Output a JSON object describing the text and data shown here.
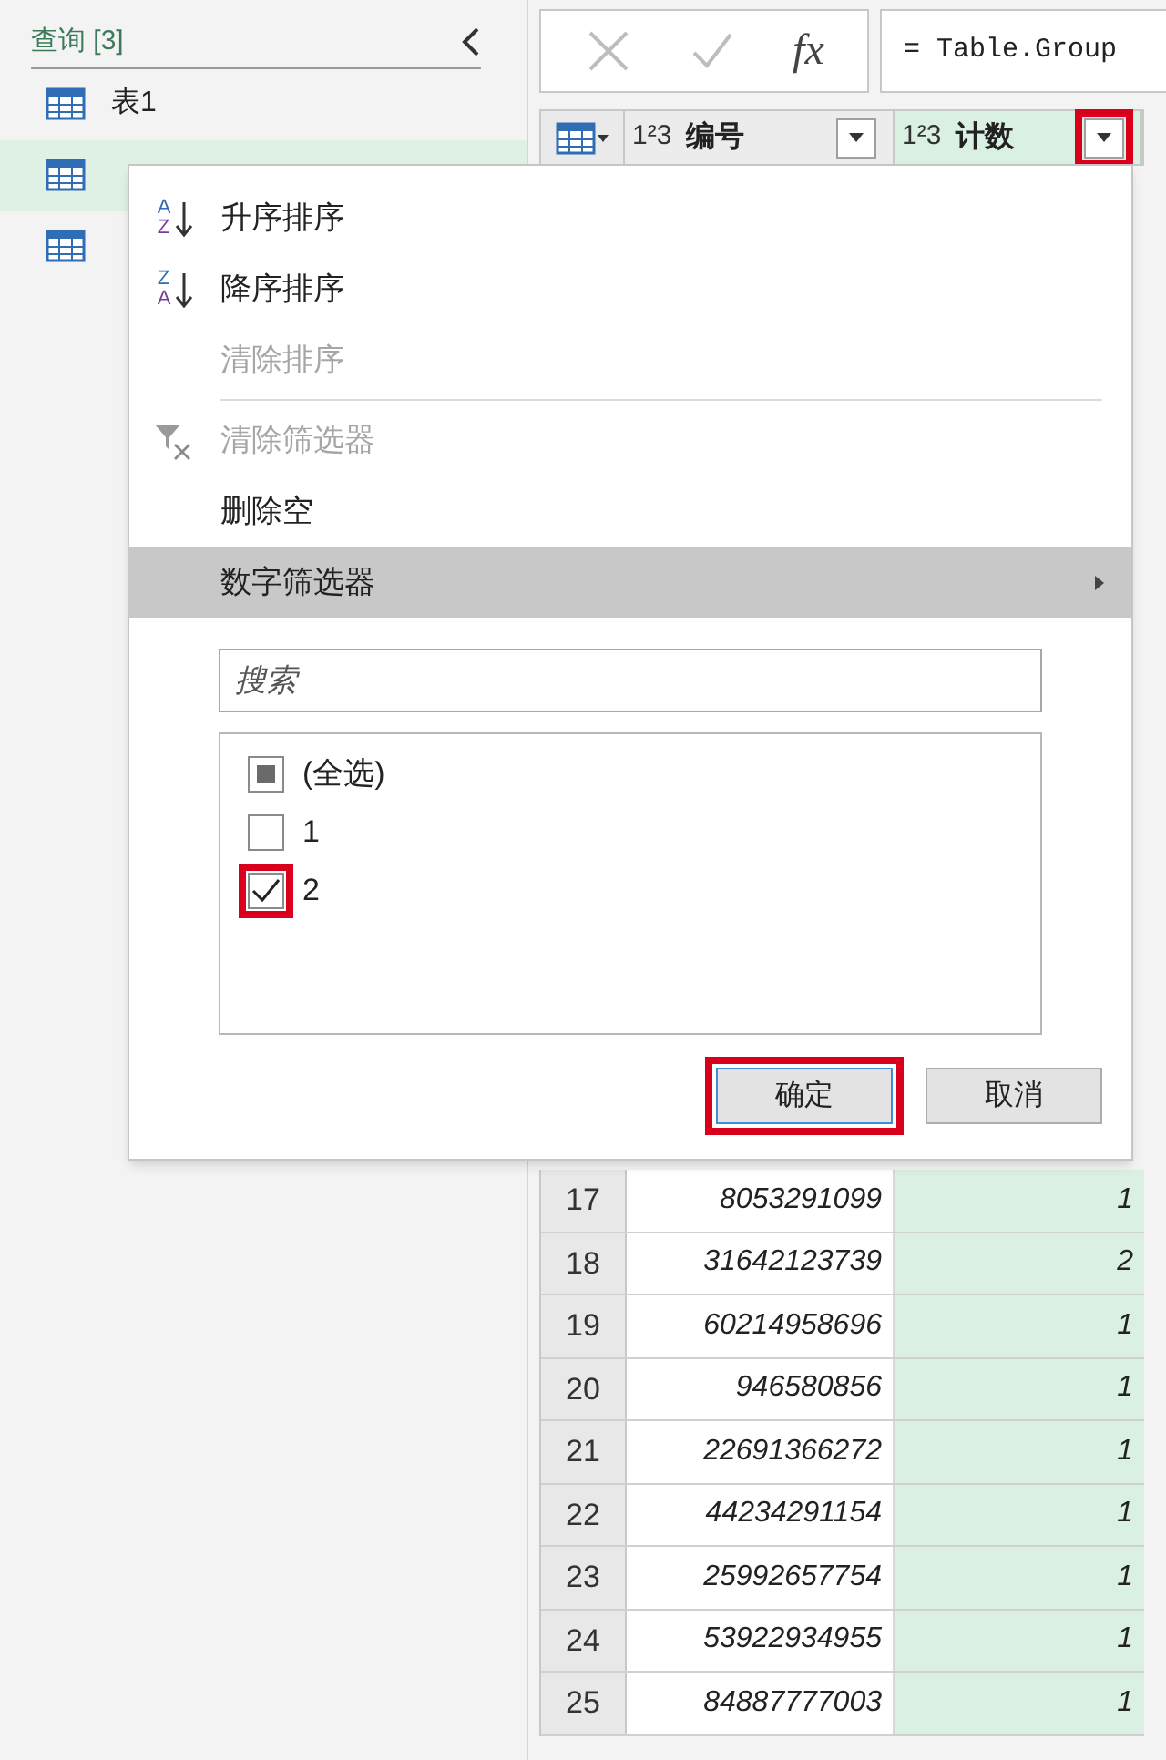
{
  "sidebar": {
    "title": "查询 [3]",
    "items": [
      {
        "label": "表1",
        "selected": false
      },
      {
        "selected": true
      },
      {
        "selected": false
      }
    ]
  },
  "formula_bar": {
    "fx": "fx",
    "formula": "= Table.Group"
  },
  "columns": [
    {
      "type_label": "1²3",
      "name": "编号",
      "highlighted": false
    },
    {
      "type_label": "1²3",
      "name": "计数",
      "highlighted": true
    }
  ],
  "rows": [
    {
      "num": "17",
      "id": "8053291099",
      "count": "1"
    },
    {
      "num": "18",
      "id": "31642123739",
      "count": "2"
    },
    {
      "num": "19",
      "id": "60214958696",
      "count": "1"
    },
    {
      "num": "20",
      "id": "946580856",
      "count": "1"
    },
    {
      "num": "21",
      "id": "22691366272",
      "count": "1"
    },
    {
      "num": "22",
      "id": "44234291154",
      "count": "1"
    },
    {
      "num": "23",
      "id": "25992657754",
      "count": "1"
    },
    {
      "num": "24",
      "id": "53922934955",
      "count": "1"
    },
    {
      "num": "25",
      "id": "84887777003",
      "count": "1"
    }
  ],
  "filter_menu": {
    "items": [
      {
        "kind": "sort_asc",
        "icon_top": "A",
        "icon_bottom": "Z",
        "label": "升序排序",
        "disabled": false,
        "selected": false
      },
      {
        "kind": "sort_desc",
        "icon_top": "Z",
        "icon_bottom": "A",
        "label": "降序排序",
        "disabled": false,
        "selected": false
      },
      {
        "kind": "plain",
        "label": "清除排序",
        "disabled": true,
        "selected": false
      },
      {
        "kind": "separator"
      },
      {
        "kind": "clear_filter",
        "label": "清除筛选器",
        "disabled": true,
        "selected": false
      },
      {
        "kind": "plain",
        "label": "删除空",
        "disabled": false,
        "selected": false
      },
      {
        "kind": "submenu",
        "label": "数字筛选器",
        "disabled": false,
        "selected": true
      }
    ],
    "search": {
      "placeholder": "搜索"
    },
    "values": [
      {
        "label": "(全选)",
        "checked": false,
        "indeterminate": true,
        "highlighted": false
      },
      {
        "label": "1",
        "checked": false,
        "indeterminate": false,
        "highlighted": false
      },
      {
        "label": "2",
        "checked": true,
        "indeterminate": false,
        "highlighted": true
      }
    ],
    "buttons": [
      {
        "label": "确定",
        "default": true,
        "highlighted": true
      },
      {
        "label": "取消",
        "default": false,
        "highlighted": false
      }
    ]
  }
}
